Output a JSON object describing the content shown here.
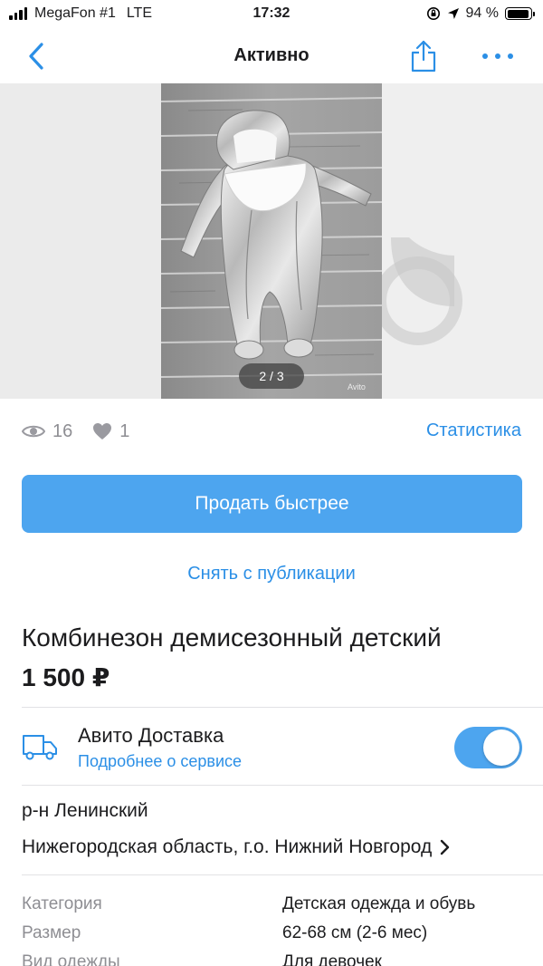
{
  "status_bar": {
    "carrier": "MegaFon #1",
    "network": "LTE",
    "time": "17:32",
    "battery": "94 %",
    "battery_level": 0.94
  },
  "nav": {
    "title": "Активно",
    "back_icon": "chevron-left-icon",
    "share_icon": "share-icon",
    "more_icon": "more-icon"
  },
  "gallery": {
    "counter": "2 / 3",
    "current": 2,
    "total": 3
  },
  "stats": {
    "views": "16",
    "likes": "1",
    "statistics_link": "Статистика"
  },
  "actions": {
    "sell_faster": "Продать быстрее",
    "unpublish": "Снять с публикации"
  },
  "ad": {
    "title": "Комбинезон демисезонный детский",
    "price": "1 500 ₽"
  },
  "delivery": {
    "title": "Авито Доставка",
    "link": "Подробнее о сервисе",
    "enabled": true
  },
  "location": {
    "district": "р-н Ленинский",
    "region": "Нижегородская область, г.о. Нижний Новгород"
  },
  "params": [
    {
      "label": "Категория",
      "value": "Детская одежда и обувь"
    },
    {
      "label": "Размер",
      "value": "62-68 см (2-6 мес)"
    },
    {
      "label": "Вид одежды",
      "value": "Для девочек"
    }
  ],
  "colors": {
    "accent": "#4da5ef",
    "link": "#2b8fe6",
    "secondary_text": "#8e8e93"
  }
}
